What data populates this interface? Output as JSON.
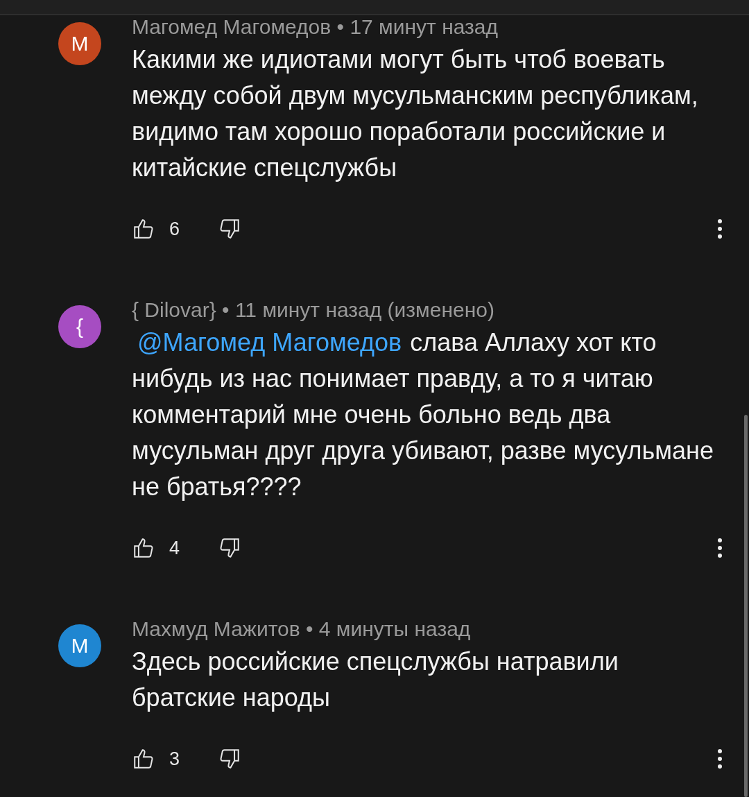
{
  "comments": [
    {
      "avatar": {
        "letter": "M",
        "color": "#c4461e"
      },
      "meta": "Магомед Магомедов • 17 минут назад",
      "text": "Какими же идиотами могут быть чтоб воевать между собой двум мусульманским республикам, видимо там хорошо поработали российские и китайские спецслужбы",
      "likes": "6"
    },
    {
      "avatar": {
        "letter": "{",
        "color": "#a64dc2"
      },
      "meta": "{ Dilovar} • 11 минут назад (изменено)",
      "mention": "@Магомед Магомедов",
      "text": "слава Аллаху хот кто нибудь из нас понимает правду, а то я читаю комментарий мне очень больно ведь два мусульман друг друга убивают, разве мусульмане не братья????",
      "likes": "4"
    },
    {
      "avatar": {
        "letter": "M",
        "color": "#1f86d1"
      },
      "meta": "Махмуд Мажитов • 4 минуты назад",
      "text": "Здесь российские спецслужбы натравили братские народы",
      "likes": "3"
    }
  ]
}
